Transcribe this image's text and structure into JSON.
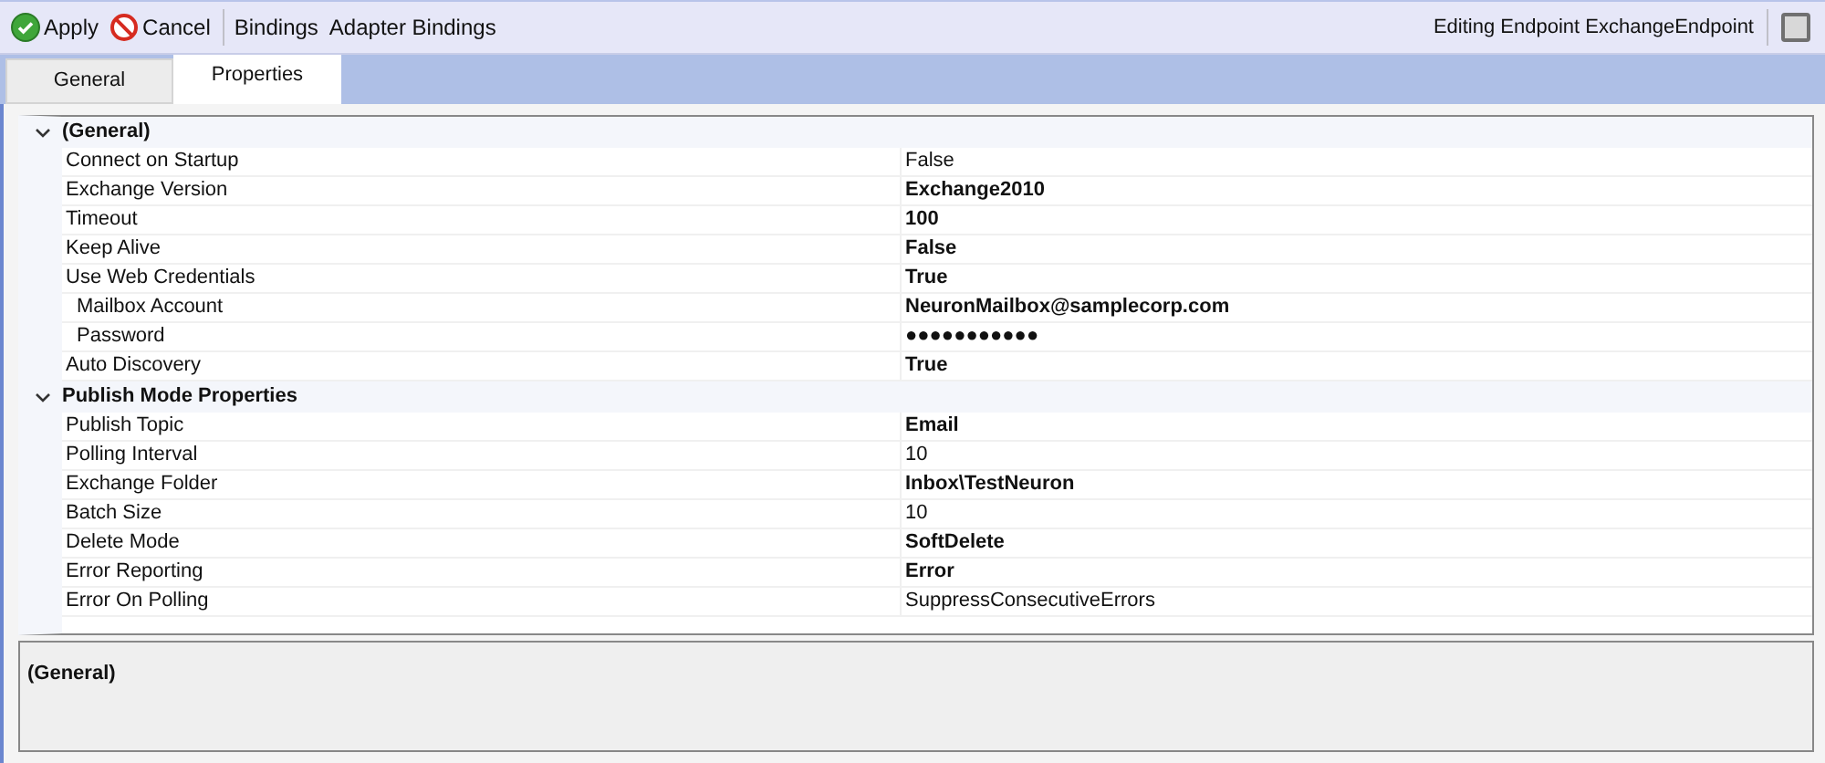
{
  "toolbar": {
    "buttons": [
      {
        "kind": "apply",
        "label": "Apply"
      },
      {
        "kind": "cancel",
        "label": "Cancel"
      },
      {
        "kind": "plain",
        "label": "Bindings"
      },
      {
        "kind": "plain",
        "label": "Adapter Bindings"
      }
    ],
    "status": "Editing Endpoint ExchangeEndpoint"
  },
  "tabs": [
    {
      "label": "General",
      "selected": false
    },
    {
      "label": "Properties",
      "selected": true
    }
  ],
  "categories": [
    {
      "name": "(General)",
      "expanded": true,
      "properties": [
        {
          "name": "Connect on Startup",
          "value": "False",
          "modified": false
        },
        {
          "name": "Exchange Version",
          "value": "Exchange2010",
          "modified": true
        },
        {
          "name": "Timeout",
          "value": "100",
          "modified": true
        },
        {
          "name": "Keep Alive",
          "value": "False",
          "modified": true
        },
        {
          "name": "Use Web Credentials",
          "value": "True",
          "modified": true,
          "children": [
            {
              "name": "Mailbox Account",
              "value": "NeuronMailbox@samplecorp.com",
              "modified": true
            },
            {
              "name": "Password",
              "value": "●●●●●●●●●●●",
              "modified": true
            }
          ]
        },
        {
          "name": "Auto Discovery",
          "value": "True",
          "modified": true
        }
      ]
    },
    {
      "name": "Publish Mode Properties",
      "expanded": true,
      "properties": [
        {
          "name": "Publish Topic",
          "value": "Email",
          "modified": true
        },
        {
          "name": "Polling Interval",
          "value": "10",
          "modified": false
        },
        {
          "name": "Exchange Folder",
          "value": "Inbox\\TestNeuron",
          "modified": true
        },
        {
          "name": "Batch Size",
          "value": "10",
          "modified": false
        },
        {
          "name": "Delete Mode",
          "value": "SoftDelete",
          "modified": true
        },
        {
          "name": "Error Reporting",
          "value": "Error",
          "modified": true
        },
        {
          "name": "Error On Polling",
          "value": "SuppressConsecutiveErrors",
          "modified": false
        }
      ]
    }
  ],
  "description": {
    "title": "(General)"
  }
}
